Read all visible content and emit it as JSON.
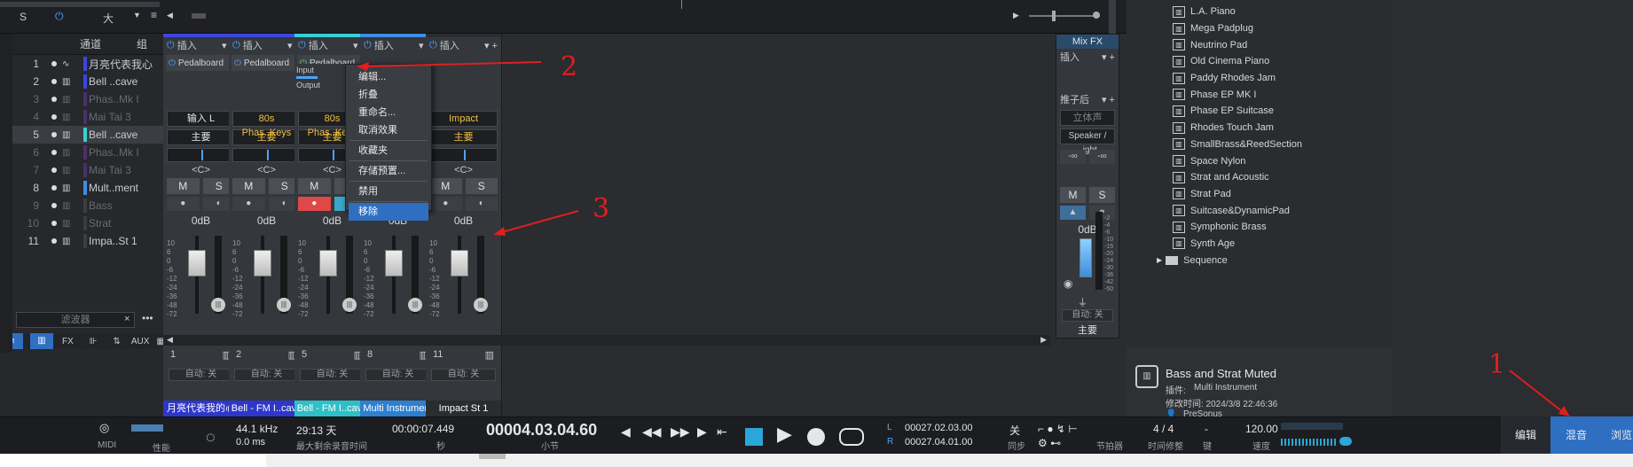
{
  "top": {
    "sel1": "S",
    "sel2": "大"
  },
  "channel_list": {
    "header": {
      "channel": "通道",
      "group": "组"
    },
    "rows": [
      {
        "num": "1",
        "name": "月亮代表我心",
        "color": "#3b46e0",
        "dim": false,
        "icon": "~"
      },
      {
        "num": "2",
        "name": "Bell ..cave",
        "color": "#3b46e0",
        "dim": false,
        "icon": "III"
      },
      {
        "num": "3",
        "name": "Phas..Mk I",
        "color": "#4a2f6b",
        "dim": true,
        "icon": "III"
      },
      {
        "num": "4",
        "name": "Mai Tai 3",
        "color": "#4a2f6b",
        "dim": true,
        "icon": "III"
      },
      {
        "num": "5",
        "name": "Bell ..cave",
        "color": "#35d0d6",
        "dim": false,
        "icon": "III",
        "selected": true
      },
      {
        "num": "6",
        "name": "Phas..Mk I",
        "color": "#4a2f6b",
        "dim": true,
        "icon": "III"
      },
      {
        "num": "7",
        "name": "Mai Tai 3",
        "color": "#4a2f6b",
        "dim": true,
        "icon": "III"
      },
      {
        "num": "8",
        "name": "Mult..ment",
        "color": "#3b8fe0",
        "dim": false,
        "icon": "III"
      },
      {
        "num": "9",
        "name": "Bass",
        "color": "#3a3d42",
        "dim": true,
        "icon": "III"
      },
      {
        "num": "10",
        "name": "Strat",
        "color": "#3a3d42",
        "dim": true,
        "icon": "III"
      },
      {
        "num": "11",
        "name": "Impa..St 1",
        "color": "#3a3d42",
        "dim": false,
        "icon": "III"
      }
    ],
    "filter_placeholder": "滤波器",
    "tabs": [
      "FX",
      "AUX"
    ]
  },
  "strips": [
    {
      "insert": "插入",
      "slot": "Pedalboard",
      "io": "输入 L",
      "io_color": "#e3e5e8",
      "bus": "主要",
      "bus_color": "#e3e5e8",
      "pan": "<C>",
      "mute": "M",
      "solo": "S",
      "db": "0dB",
      "num": "1",
      "auto": "自动: 关",
      "name": "月亮代表我的心",
      "name_bg": "#2e37c9",
      "cap": "#3b46e0"
    },
    {
      "insert": "插入",
      "slot": "Pedalboard",
      "io": "80s Phas..Keys",
      "io_color": "#f0c040",
      "bus": "主要",
      "bus_color": "#f0c040",
      "pan": "<C>",
      "mute": "M",
      "solo": "S",
      "db": "0dB",
      "num": "2",
      "auto": "自动: 关",
      "name": "Bell - FM I..cave",
      "name_bg": "#2e37c9",
      "cap": "#3b46e0"
    },
    {
      "insert": "插入",
      "slot": "Pedalboard",
      "io": "80s Phas..Keys",
      "io_color": "#f0c040",
      "bus": "主要",
      "bus_color": "#f0c040",
      "pan": "<C>",
      "mute": "M",
      "solo": "S",
      "db": "0dB",
      "num": "5",
      "auto": "自动: 关",
      "name": "Bell - FM I..cave",
      "name_bg": "#2fbfc6",
      "cap": "#35d0d6"
    },
    {
      "insert": "插入",
      "slot": "",
      "io": "",
      "io_color": "#e3e5e8",
      "bus": "",
      "bus_color": "#e3e5e8",
      "pan": "<C>",
      "mute": "M",
      "solo": "S",
      "db": "0dB",
      "num": "8",
      "auto": "自动: 关",
      "name": "Multi Instrument",
      "name_bg": "#2f7fd0",
      "cap": "#3b8fe0"
    },
    {
      "insert": "插入",
      "slot": "",
      "io": "Impact",
      "io_color": "#f0c040",
      "bus": "主要",
      "bus_color": "#f0c040",
      "pan": "<C>",
      "mute": "M",
      "solo": "S",
      "db": "0dB",
      "num": "11",
      "auto": "自动: 关",
      "name": "Impact St 1",
      "name_bg": "#2a2c30",
      "cap": "#2a2c30"
    }
  ],
  "input_label": "Input",
  "output_label": "Output",
  "main_strip": {
    "mixfx": "Mix FX",
    "insert": "插入",
    "post": "推子后",
    "stereo": "立体声",
    "out": "Speaker / ..ight",
    "mute": "M",
    "solo": "S",
    "db": "0dB",
    "auto": "自动: 关",
    "name": "主要"
  },
  "fader_scale": [
    "10",
    "6",
    "0",
    "-6",
    "-12",
    "-24",
    "-36",
    "-48",
    "-72"
  ],
  "main_scale": [
    "-2",
    "-4",
    "-6",
    "-10",
    "-15",
    "-20",
    "-24",
    "-30",
    "-36",
    "-42",
    "-50"
  ],
  "context_menu": [
    "编辑...",
    "折叠",
    "重命名...",
    "取消效果",
    "收藏夹",
    "存储预置...",
    "禁用",
    "移除"
  ],
  "browser": {
    "items": [
      "L.A. Piano",
      "Mega Padplug",
      "Neutrino Pad",
      "Old Cinema Piano",
      "Paddy Rhodes Jam",
      "Phase EP MK I",
      "Phase EP Suitcase",
      "Rhodes Touch Jam",
      "SmallBrass&ReedSection",
      "Space Nylon",
      "Strat and Acoustic",
      "Strat Pad",
      "Suitcase&DynamicPad",
      "Symphonic Brass",
      "Synth Age"
    ],
    "folder": "Sequence",
    "info_title": "Bass and Strat Muted",
    "info_plugin_label": "插件:",
    "info_plugin": "Multi Instrument",
    "info_modified": "修改时间: 2024/3/8 22:46:36",
    "info_vendor": "PreSonus"
  },
  "transport": {
    "midi": "MIDI",
    "perf": "性能",
    "rate": "44.1 kHz",
    "latency": "0.0 ms",
    "days": "29:13 天",
    "days_label": "最大剩余录音时间",
    "time": "00:00:07.449",
    "time_unit": "秒",
    "bars": "00004.03.04.60",
    "bars_unit": "小节",
    "loop_l": "00027.02.03.00",
    "loop_r": "00027.04.01.00",
    "L": "L",
    "R": "R",
    "sync": "关",
    "sync_label": "同步",
    "metro_label": "节拍器",
    "sig": "4 / 4",
    "sig_label": "时间修整",
    "key": "-",
    "key_label": "键",
    "tempo": "120.00",
    "tempo_label": "速度"
  },
  "right_buttons": {
    "edit": "编辑",
    "mix": "混音",
    "browse": "浏览"
  },
  "annotations": [
    "1",
    "2",
    "3"
  ],
  "colors": {
    "accent": "#2f6fc2",
    "annotation": "#e01e1e"
  }
}
